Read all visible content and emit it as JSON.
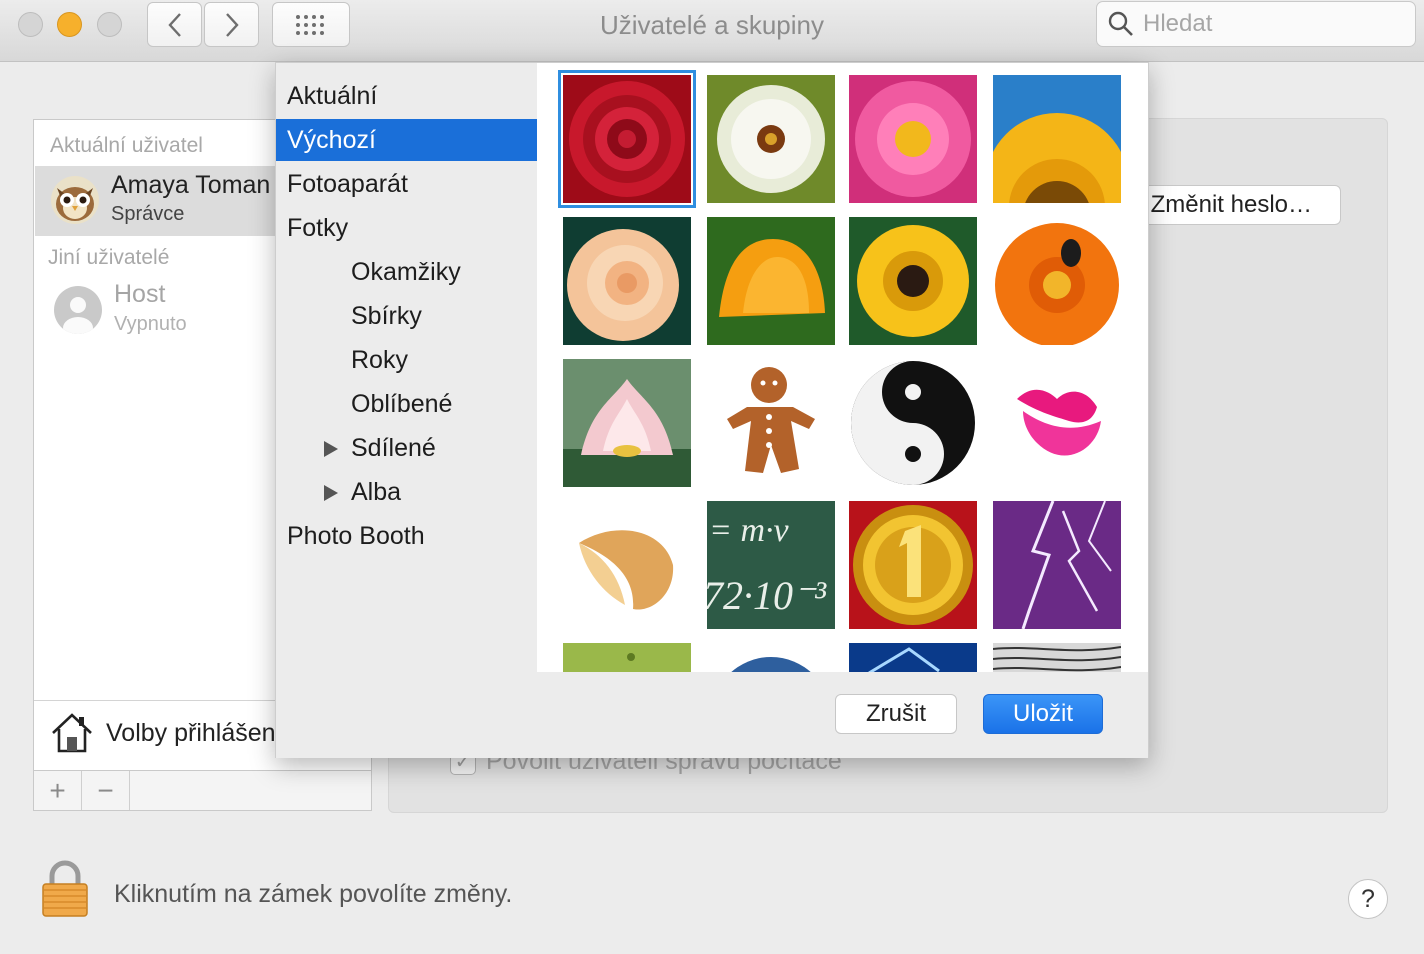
{
  "window": {
    "title": "Uživatelé a skupiny"
  },
  "search": {
    "placeholder": "Hledat"
  },
  "users": {
    "current_label": "Aktuální uživatel",
    "current": {
      "name": "Amaya Toman",
      "role": "Správce"
    },
    "others_label": "Jiní uživatelé",
    "guest": {
      "name": "Host",
      "status": "Vypnuto"
    },
    "login_options": "Volby přihlášení",
    "add": "+",
    "remove": "−"
  },
  "detail": {
    "change_password": "Změnit heslo…",
    "admin_checkbox": "Povolit uživateli správu počítače",
    "admin_checked": "✓"
  },
  "lock": {
    "text": "Kliknutím na zámek povolíte změny."
  },
  "help": "?",
  "picker": {
    "sources": [
      {
        "label": "Aktuální"
      },
      {
        "label": "Výchozí"
      },
      {
        "label": "Fotoaparát"
      },
      {
        "label": "Fotky"
      },
      {
        "label": "Okamžiky"
      },
      {
        "label": "Sbírky"
      },
      {
        "label": "Roky"
      },
      {
        "label": "Oblíbené"
      },
      {
        "label": "Sdílené"
      },
      {
        "label": "Alba"
      },
      {
        "label": "Photo Booth"
      }
    ],
    "selected_source": "Výchozí",
    "pictures": [
      "red-rose",
      "dandelion",
      "pink-dahlia",
      "sunflower",
      "peach-rose",
      "orange-poppy",
      "black-eyed-susan",
      "orange-gerbera",
      "water-lily",
      "gingerbread-man",
      "yin-yang",
      "lipstick-kiss",
      "fortune-cookie",
      "chalkboard",
      "gold-medal",
      "lightning",
      "leaf",
      "earth",
      "ice",
      "zebra"
    ],
    "cancel": "Zrušit",
    "save": "Uložit",
    "chalkboard_text": [
      "= m·v",
      "72·10⁻³"
    ]
  },
  "colors": {
    "accent": "#1a6fd9",
    "selection_ring": "#2f8ee0"
  }
}
